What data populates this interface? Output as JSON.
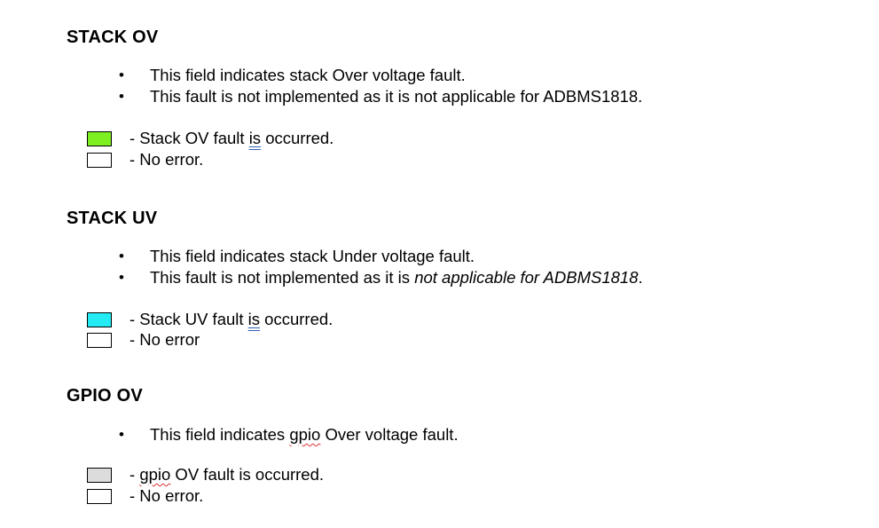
{
  "sections": [
    {
      "heading": "STACK OV",
      "bullets": [
        "This field indicates stack Over voltage fault.",
        "This fault is not implemented as it is not applicable for ADBMS1818."
      ],
      "legend": [
        {
          "color": "#7ef021",
          "pre": "- Stack OV fault ",
          "mark": "is",
          "post": " occurred."
        },
        {
          "color": "#ffffff",
          "text": "- No error."
        }
      ]
    },
    {
      "heading": "STACK UV",
      "bullets": [
        {
          "text": "This field indicates stack Under voltage fault."
        },
        {
          "pre": "This fault is not implemented as it is ",
          "italic": "not applicable for ADBMS1818",
          "post": "."
        }
      ],
      "legend": [
        {
          "color": "#24ecf4",
          "pre": "- Stack UV fault ",
          "mark": "is",
          "post": " occurred."
        },
        {
          "color": "#ffffff",
          "text": "- No error"
        }
      ]
    },
    {
      "heading": "GPIO OV",
      "bullets": [
        {
          "pre": "This field indicates ",
          "mark": "gpio",
          "post": " Over voltage fault."
        }
      ],
      "legend": [
        {
          "color": "#dcdcdc",
          "pre": "- ",
          "mark": "gpio",
          "post": " OV fault is occurred."
        },
        {
          "color": "#ffffff",
          "text": "- No error."
        }
      ]
    }
  ],
  "bullet_glyph": "•"
}
